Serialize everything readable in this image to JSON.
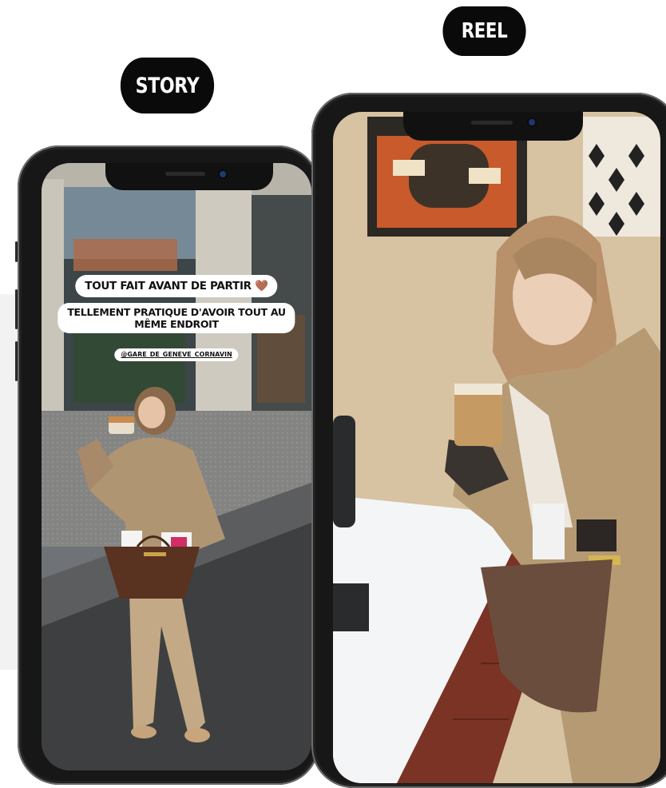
{
  "labels": {
    "story": "STORY",
    "reel": "REEL"
  },
  "story": {
    "caption_1": "TOUT FAIT AVANT DE PARTIR",
    "caption_1_emoji": "🤎",
    "caption_2_line1": "TELLEMENT PRATIQUE D'AVOIR TOUT AU",
    "caption_2_line2": "MÊME ENDROIT",
    "mention": "@GARE_DE_GENEVE_CORNAVIN"
  },
  "colors": {
    "pill_bg": "#0a0a0a",
    "phone_frame": "#171717",
    "caption_bg": "#ffffff",
    "coat": "#b59a74",
    "bag": "#5a3220"
  }
}
